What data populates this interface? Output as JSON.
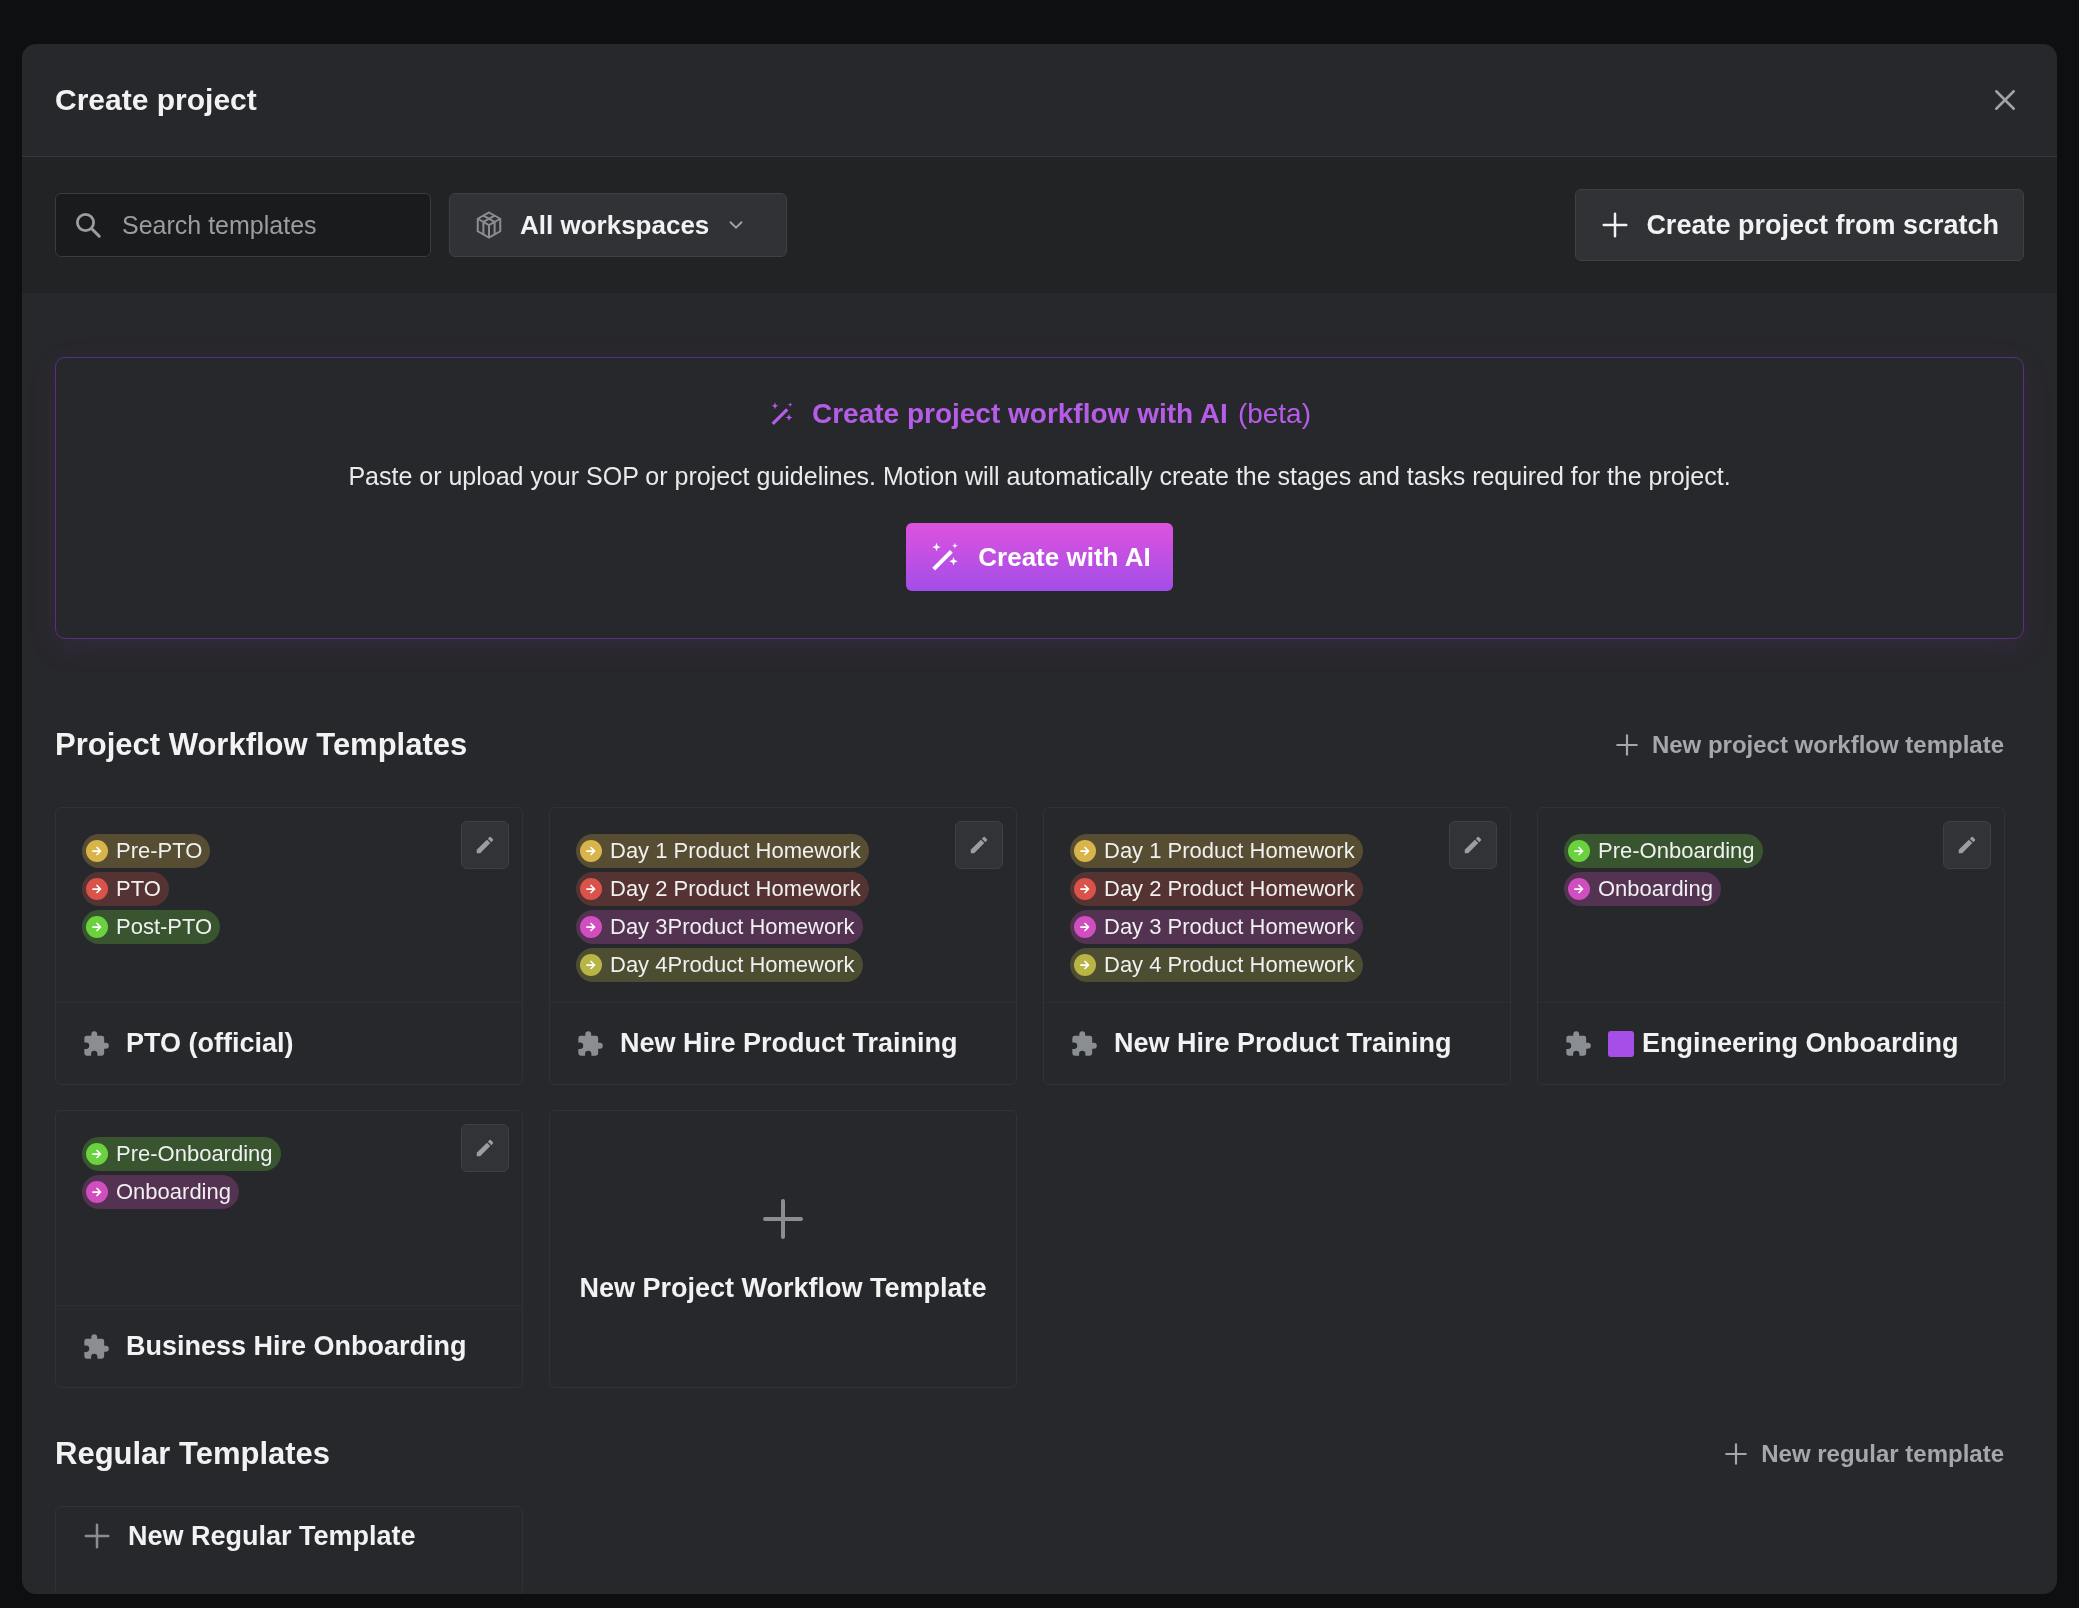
{
  "dialog": {
    "title": "Create project"
  },
  "toolbar": {
    "search": {
      "placeholder": "Search templates"
    },
    "workspace_filter": "All workspaces",
    "create_button": "Create project from scratch"
  },
  "ai_panel": {
    "title": "Create project workflow with AI",
    "title_suffix": "(beta)",
    "description": "Paste or upload your SOP or project guidelines. Motion will automatically create the stages and tasks required for the project.",
    "button": "Create with AI"
  },
  "workflow_templates": {
    "heading": "Project Workflow Templates",
    "new_link": "New project workflow template",
    "templates": [
      {
        "name": "PTO (official)",
        "stages": [
          {
            "label": "Pre-PTO",
            "color": "#d8b44a"
          },
          {
            "label": "PTO",
            "color": "#d9534a"
          },
          {
            "label": "Post-PTO",
            "color": "#6ad23f"
          }
        ]
      },
      {
        "name": "New Hire Product Training",
        "stages": [
          {
            "label": "Day 1 Product Homework",
            "color": "#d8b44a"
          },
          {
            "label": "Day 2 Product Homework",
            "color": "#d9534a"
          },
          {
            "label": "Day 3Product Homework",
            "color": "#d04ec0"
          },
          {
            "label": "Day 4Product Homework",
            "color": "#b8b446"
          }
        ]
      },
      {
        "name": "New Hire Product Training",
        "stages": [
          {
            "label": "Day 1 Product Homework",
            "color": "#d8b44a"
          },
          {
            "label": "Day 2 Product Homework",
            "color": "#d9534a"
          },
          {
            "label": "Day 3 Product Homework",
            "color": "#d04ec0"
          },
          {
            "label": "Day 4 Product Homework",
            "color": "#b8b446"
          }
        ]
      },
      {
        "name": "Engineering Onboarding",
        "color": "#a64fe8",
        "stages": [
          {
            "label": "Pre-Onboarding",
            "color": "#6ad23f"
          },
          {
            "label": "Onboarding",
            "color": "#d04ec0"
          }
        ]
      },
      {
        "name": "Business Hire Onboarding",
        "stages": [
          {
            "label": "Pre-Onboarding",
            "color": "#6ad23f"
          },
          {
            "label": "Onboarding",
            "color": "#d04ec0"
          }
        ]
      }
    ],
    "new_card": "New Project Workflow Template"
  },
  "regular_templates": {
    "heading": "Regular Templates",
    "new_link": "New regular template",
    "new_card": "New Regular Template"
  }
}
